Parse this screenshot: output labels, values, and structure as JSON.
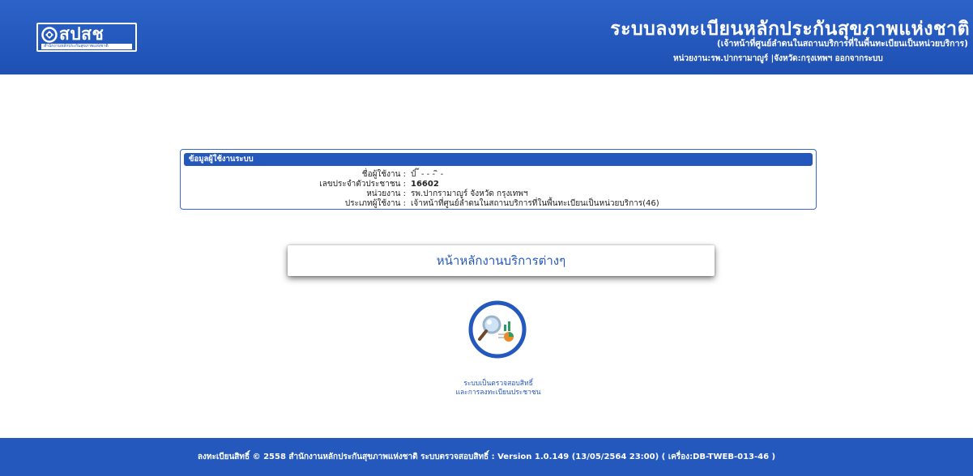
{
  "header": {
    "logo_text": "สปสช",
    "logo_subtext": "สำนักงานหลักประกันสุขภาพแห่งชาติ",
    "title": "ระบบลงทะเบียนหลักประกันสุขภาพแห่งชาติ",
    "subtitle": "(เจ้าหน้าที่ศูนย์ลำดนในสถานบริการที่ในพื้นทะเบียนเป็นหน่วยบริการ)",
    "unit_line": "หน่วยงาน:รพ.ปากรามาญูร์ |จังหวัด:กรุงเทพฯ ออกจากระบบ"
  },
  "user_info": {
    "heading": "ข้อมูลผู้ใช้งานระบบ",
    "rows": [
      {
        "label": "ชื่อผู้ใช้งาน :",
        "value": "ป์ ๊ ‑  ‑  ‑ ิ ‑"
      },
      {
        "label": "เลขประจำตัวประชาชน :",
        "value": "16602"
      },
      {
        "label": "หน่วยงาน :",
        "value": "รพ.ปากรามาญูร์ จังหวัด กรุงเทพฯ"
      },
      {
        "label": "ประเภทผู้ใช้งาน :",
        "value": "เจ้าหน้าที่ศูนย์ลำดนในสถานบริการที่ในพื้นทะเบียนเป็นหน่วยบริการ(46)"
      }
    ]
  },
  "main_menu": {
    "label": "หน้าหลักงานบริการต่างๆ"
  },
  "service": {
    "icon": "search-report-icon",
    "caption_line1": "ระบบเป็นตรวจสอบสิทธิ์",
    "caption_line2": "และการลงทะเบียนประชาชน"
  },
  "footer": {
    "text": "ลงทะเบียนสิทธิ์ © 2558 สำนักงานหลักประกันสุขภาพแห่งชาติ ระบบตรวจสอบสิทธิ์ : Version 1.0.149 (13/05/2564 23:00)  ( เครื่อง:DB-TWEB-013-46 )"
  },
  "colors": {
    "brand": "#2458bd",
    "header_bg": "#2d63c8",
    "background": "#ffffff"
  }
}
